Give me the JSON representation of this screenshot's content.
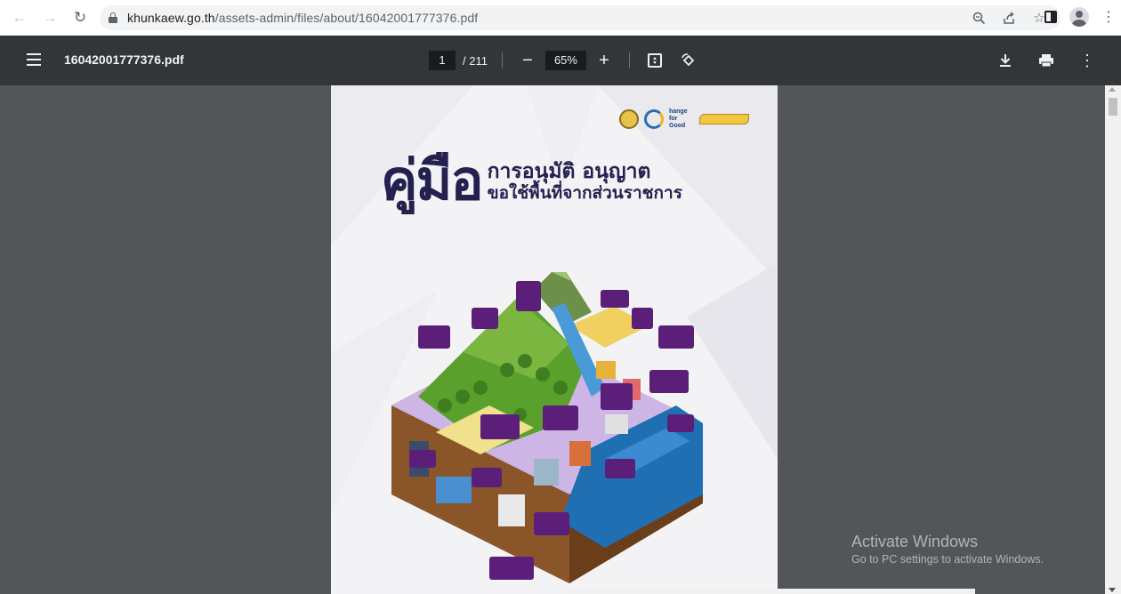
{
  "browser": {
    "url_host": "khunkaew.go.th",
    "url_path": "/assets-admin/files/about/16042001777376.pdf",
    "icons": [
      "back-icon",
      "forward-icon",
      "reload-icon",
      "lock-icon",
      "zoom-icon",
      "share-icon",
      "star-icon",
      "side-panel-icon",
      "profile-icon",
      "menu-icon"
    ]
  },
  "pdf_toolbar": {
    "file_name": "16042001777376.pdf",
    "current_page": "1",
    "total_pages": "/ 211",
    "zoom": "65%",
    "icons": [
      "hamburger-icon",
      "zoom-out-icon",
      "zoom-in-icon",
      "fit-page-icon",
      "rotate-icon",
      "download-icon",
      "print-icon",
      "more-icon"
    ]
  },
  "cover": {
    "title_big": "คู่มือ",
    "title_line1": "การอนุมัติ อนุญาต",
    "title_line2": "ขอใช้พื้นที่จากส่วนราชการ",
    "logo_text": "hange for Good"
  },
  "watermark": {
    "title": "Activate Windows",
    "subtitle": "Go to PC settings to activate Windows."
  },
  "colors": {
    "toolbar": "#323639",
    "viewer_bg": "#525659",
    "title_navy": "#24204f",
    "label_purple": "#5b1f7a"
  }
}
